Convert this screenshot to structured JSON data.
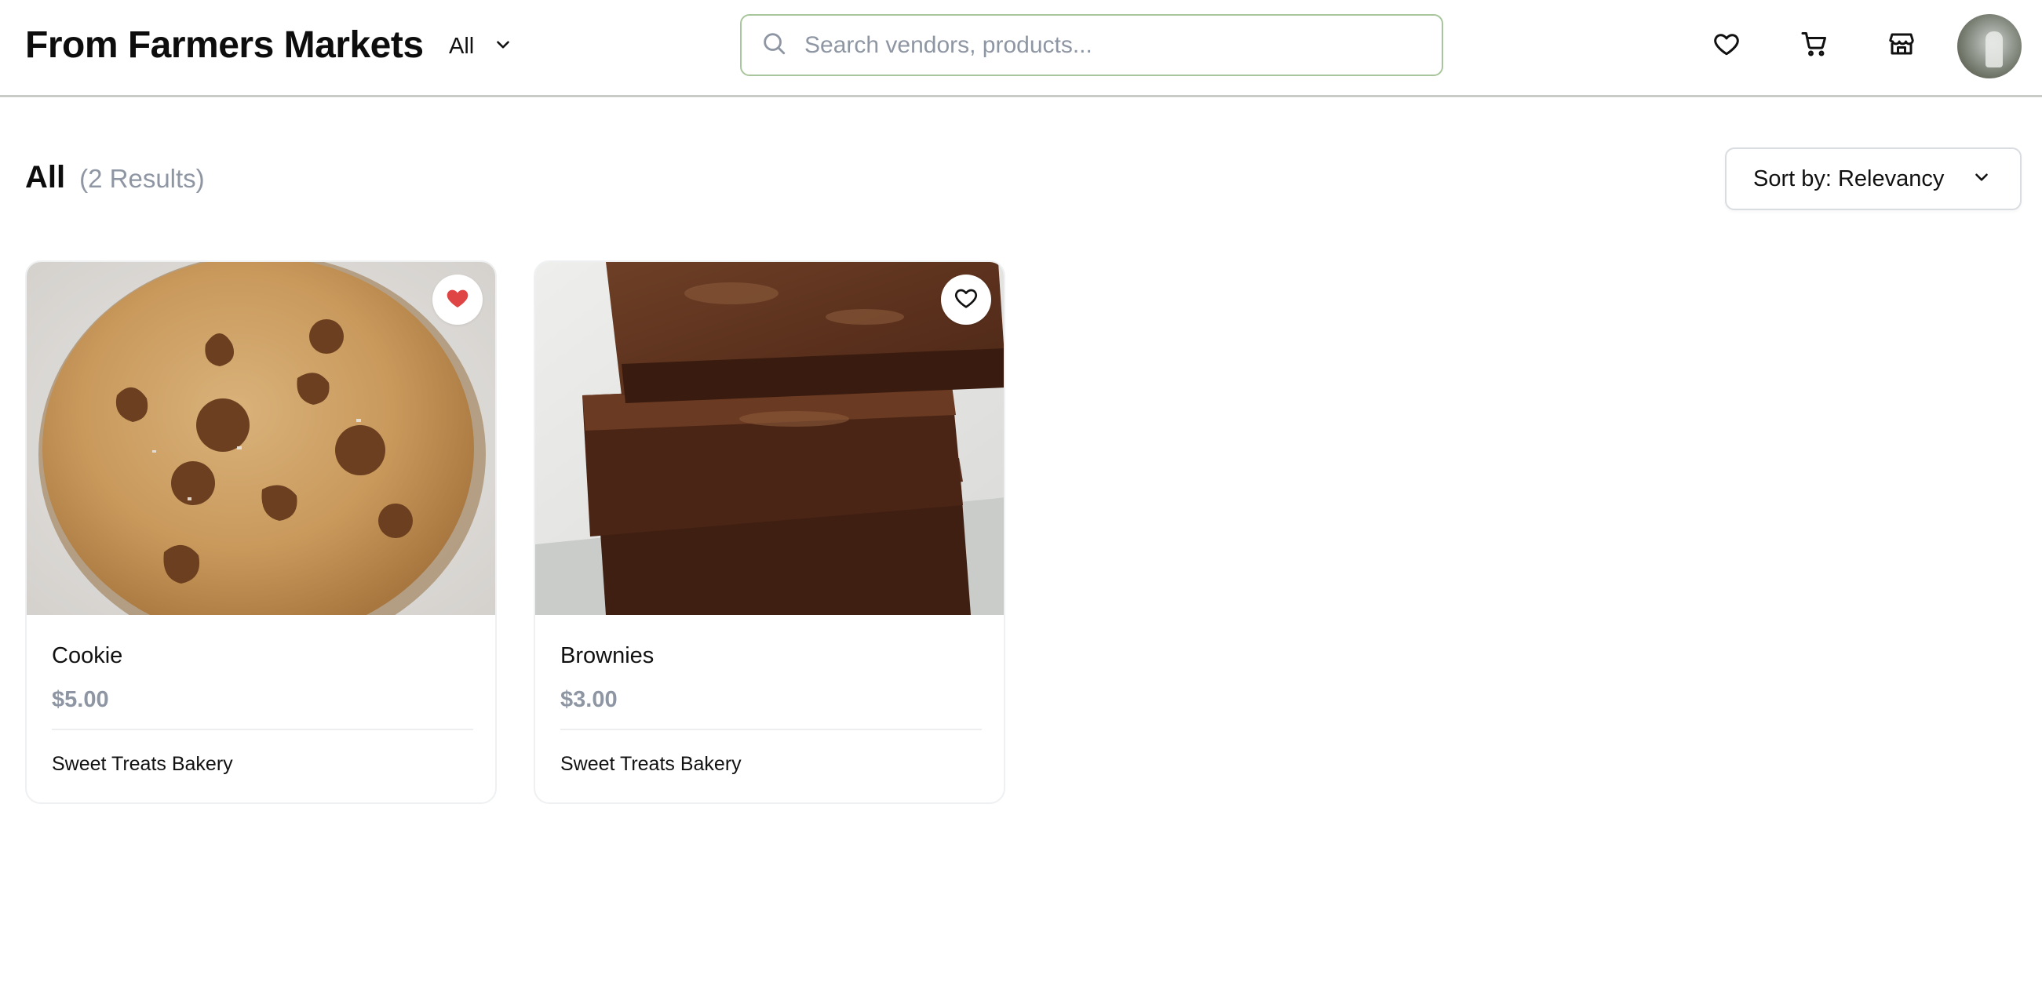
{
  "header": {
    "brand": "From Farmers Markets",
    "category_select": {
      "value": "All"
    },
    "search": {
      "placeholder": "Search vendors, products...",
      "value": ""
    },
    "icons": [
      "heart-icon",
      "cart-icon",
      "store-icon"
    ],
    "accent_border": "#a8c59b"
  },
  "results": {
    "category": "All",
    "count_text": "(2 Results)",
    "sort": {
      "value": "Sort by: Relevancy"
    }
  },
  "products": [
    {
      "name": "Cookie",
      "price": "$5.00",
      "vendor": "Sweet Treats Bakery",
      "favorited": true,
      "image": "chocolate-chip-cookie"
    },
    {
      "name": "Brownies",
      "price": "$3.00",
      "vendor": "Sweet Treats Bakery",
      "favorited": false,
      "image": "stacked-brownies"
    }
  ],
  "colors": {
    "favorite_red": "#e04545",
    "muted_text": "#8e96a3"
  }
}
